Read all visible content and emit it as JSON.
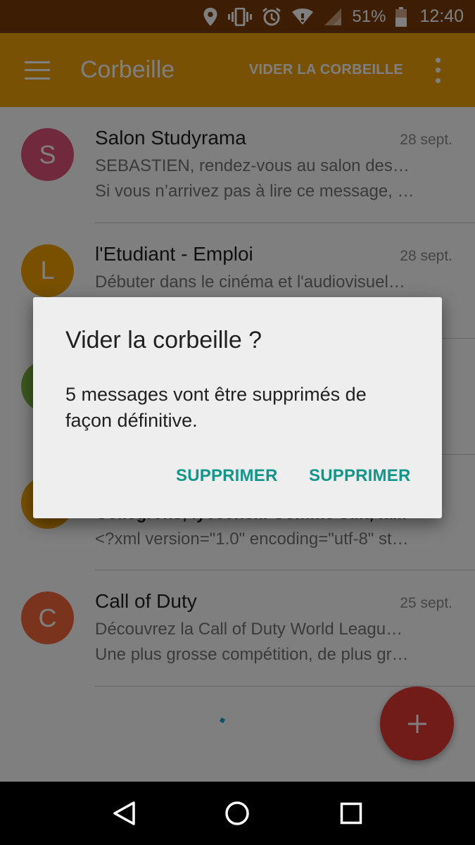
{
  "status_bar": {
    "battery": "51%",
    "time": "12:40",
    "icons": [
      "location-icon",
      "vibrate-icon",
      "alarm-icon",
      "wifi-icon",
      "signal-icon",
      "battery-icon"
    ]
  },
  "app_bar": {
    "title": "Corbeille",
    "action_label": "VIDER LA CORBEILLE",
    "color": "#f0a30a"
  },
  "emails": [
    {
      "initial": "S",
      "color": "#e0527a",
      "sender": "Salon Studyrama",
      "date": "28 sept.",
      "line1": "SEBASTIEN, rendez-vous au salon des…",
      "line2": "Si vous n’arrivez pas à lire ce message, …"
    },
    {
      "initial": "L",
      "color": "#f0a000",
      "sender": "l'Etudiant - Emploi",
      "date": "28 sept.",
      "line1": "Débuter dans le cinéma et l'audiovisuel…",
      "line2": ""
    },
    {
      "initial": "",
      "color": "#7cb342",
      "sender": "",
      "date": "",
      "line1": "",
      "line2": ""
    },
    {
      "initial": "",
      "color": "#f0a000",
      "sender": "",
      "date": "",
      "line1": "Collegrens, lycéens... Comme suit, la...",
      "line2": "<?xml version=\"1.0\" encoding=\"utf-8\" st…"
    },
    {
      "initial": "C",
      "color": "#f4673a",
      "sender": "Call of Duty",
      "date": "25 sept.",
      "line1": "Découvrez la Call of Duty World Leagu…",
      "line2": "Une plus grosse compétition, de plus gr…"
    }
  ],
  "dialog": {
    "title": "Vider la corbeille ?",
    "message": "5 messages vont être supprimés de façon définitive.",
    "button_left": "SUPPRIMER",
    "button_right": "SUPPRIMER",
    "accent": "#13968a"
  },
  "fab": {
    "color": "#e53935",
    "icon": "plus-icon"
  }
}
